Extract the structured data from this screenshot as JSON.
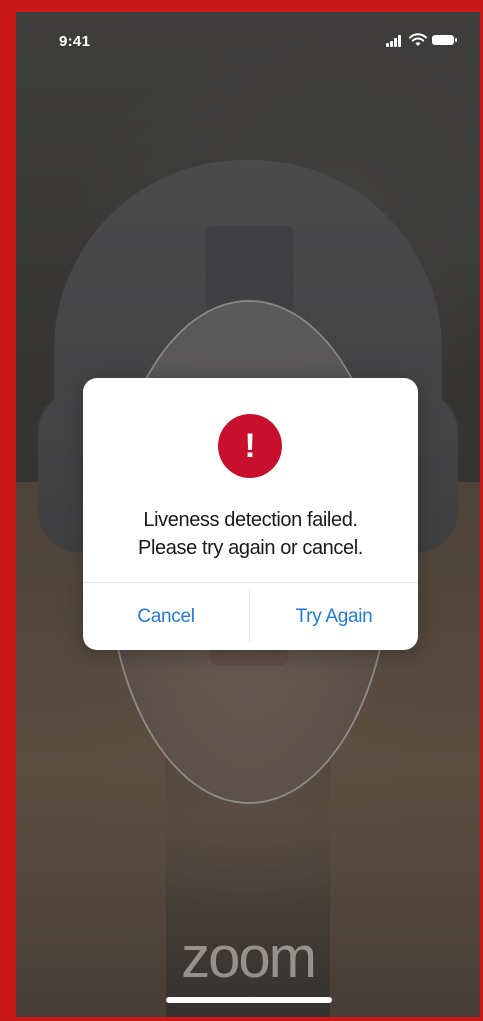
{
  "status_bar": {
    "time": "9:41",
    "icons": [
      "signal-icon",
      "wifi-icon",
      "battery-icon"
    ]
  },
  "dialog": {
    "icon": "alert-icon",
    "icon_glyph": "!",
    "message_line1": "Liveness detection failed.",
    "message_line2": "Please try again or cancel.",
    "cancel_label": "Cancel",
    "try_again_label": "Try Again"
  },
  "brand": {
    "logo_text": "zoom"
  },
  "colors": {
    "alert_red": "#c8102e",
    "button_blue": "#1f7ae0",
    "frame_red": "#c91818"
  }
}
